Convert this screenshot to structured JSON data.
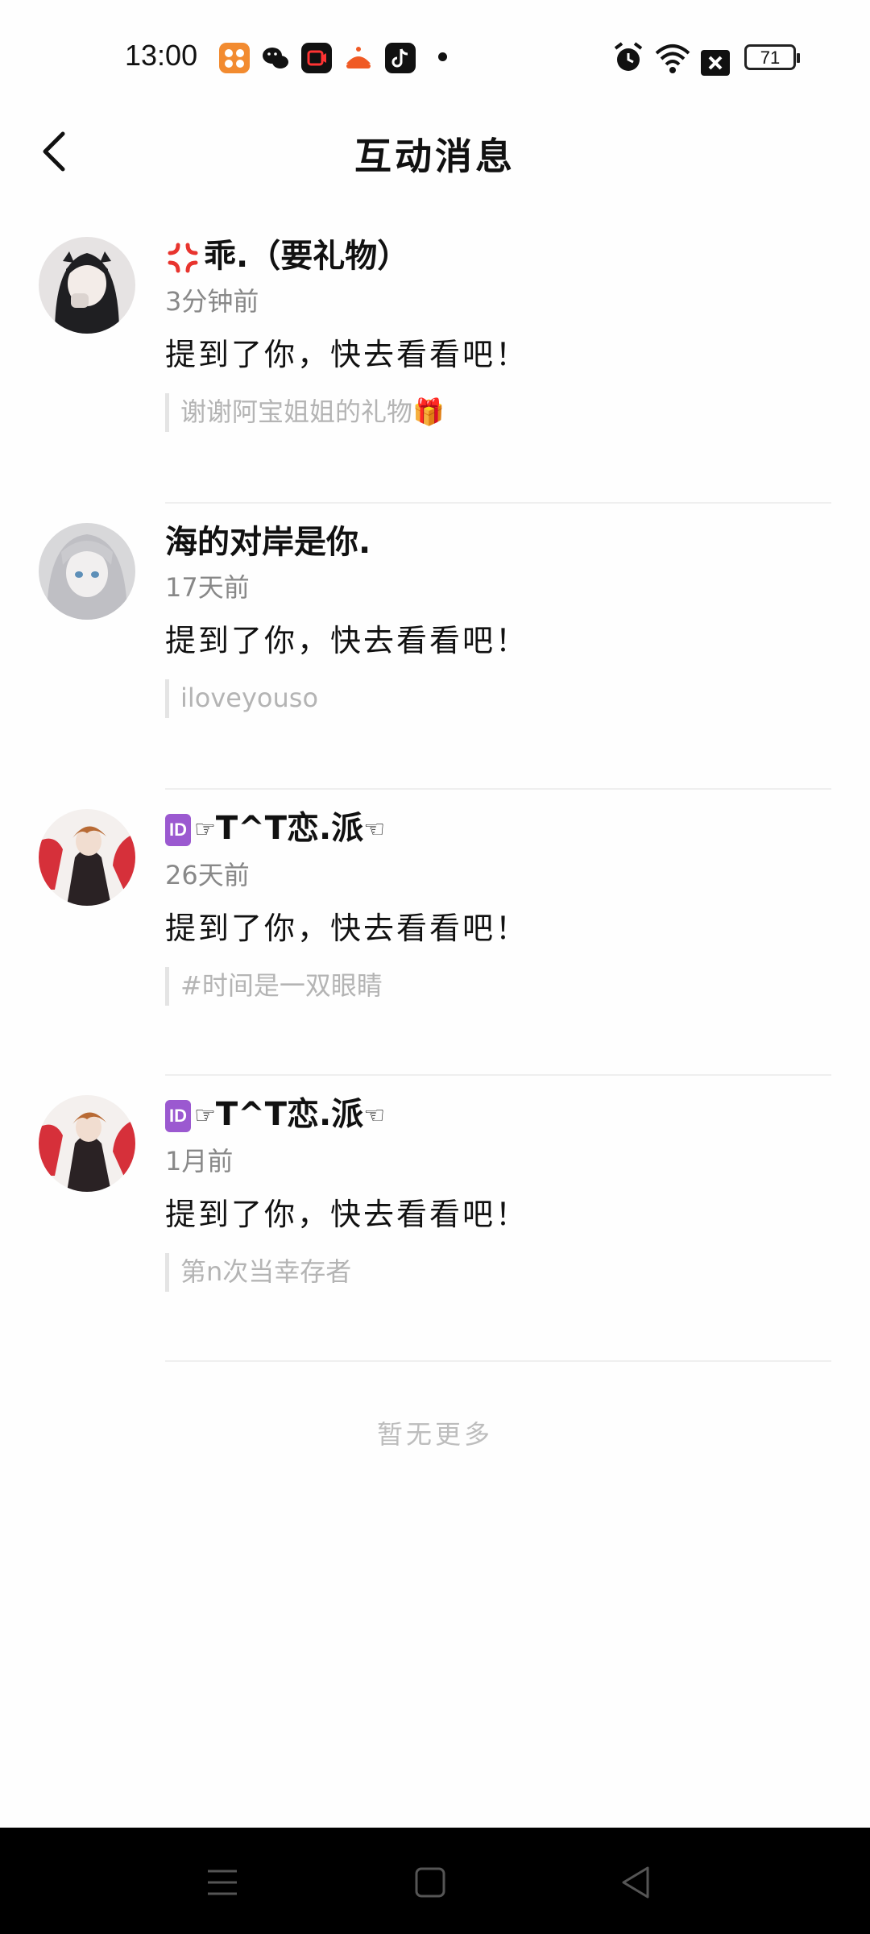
{
  "status_bar": {
    "time": "13:00",
    "battery": "71",
    "notification_apps": [
      "orange-app-icon",
      "wechat-icon",
      "video-app-icon",
      "taobao-icon",
      "tiktok-icon"
    ],
    "system_icons": [
      "alarm-icon",
      "wifi-icon",
      "sim-off-icon",
      "battery-icon"
    ]
  },
  "header": {
    "title": "互动消息"
  },
  "messages": [
    {
      "name": "乖.（要礼物）",
      "time": "3分钟前",
      "text": "提到了你，快去看看吧！",
      "quote": "谢谢阿宝姐姐的礼物🎁"
    },
    {
      "name": "海的对岸是你.",
      "time": "17天前",
      "text": "提到了你，快去看看吧！",
      "quote": "iloveyouso"
    },
    {
      "name": "T^T恋.派",
      "time": "26天前",
      "text": "提到了你，快去看看吧！",
      "quote": "#时间是一双眼睛"
    },
    {
      "name": "T^T恋.派",
      "time": "1月前",
      "text": "提到了你，快去看看吧！",
      "quote": "第n次当幸存者"
    }
  ],
  "footer": {
    "no_more": "暂无更多"
  },
  "badge_text": "ID",
  "colors": {
    "background": "#fefefe",
    "divider": "#efefef",
    "secondary_text": "#888888",
    "quote_text": "#b4b4b4",
    "badge": "#9b59d0"
  }
}
